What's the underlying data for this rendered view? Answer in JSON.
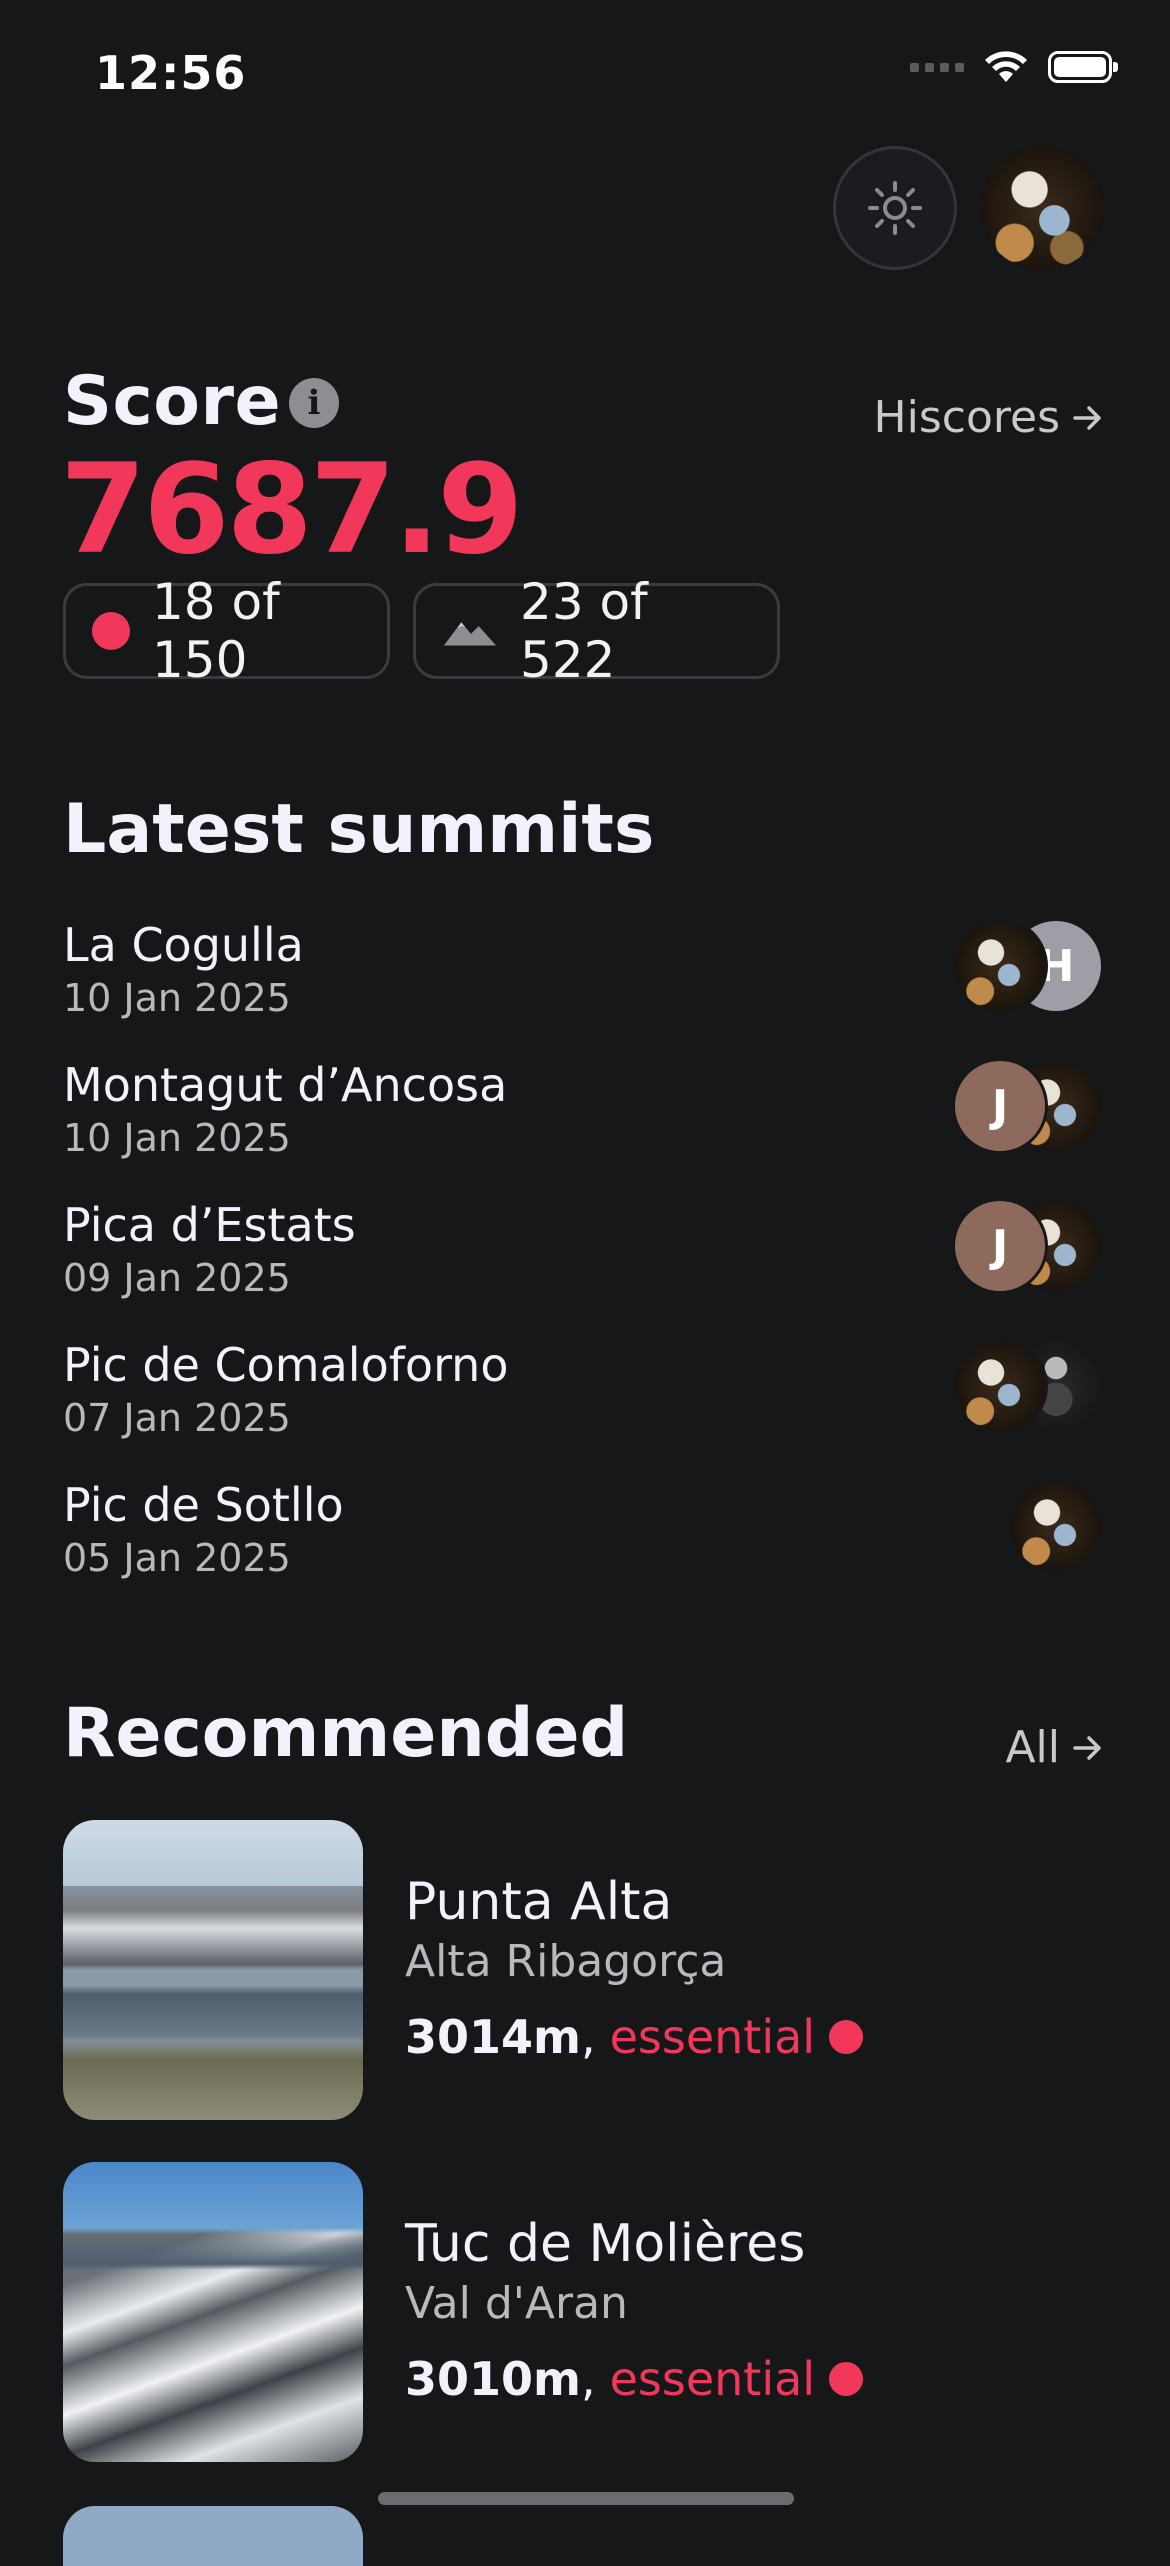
{
  "status_bar": {
    "time": "12:56"
  },
  "score": {
    "label": "Score",
    "value": "7687.9",
    "hiscores_label": "Hiscores",
    "essential_count": "18 of 150",
    "peaks_count": "23 of 522"
  },
  "latest_summits": {
    "title": "Latest summits",
    "items": [
      {
        "name": "La Cogulla",
        "date": "10 Jan 2025",
        "avatars": [
          "photo",
          "H"
        ]
      },
      {
        "name": "Montagut d’Ancosa",
        "date": "10 Jan 2025",
        "avatars": [
          "J",
          "photo"
        ]
      },
      {
        "name": "Pica d’Estats",
        "date": "09 Jan 2025",
        "avatars": [
          "J",
          "photo"
        ]
      },
      {
        "name": "Pic de Comaloforno",
        "date": "07 Jan 2025",
        "avatars": [
          "photo",
          "photo2"
        ]
      },
      {
        "name": "Pic de Sotllo",
        "date": "05 Jan 2025",
        "avatars": [
          "photo"
        ]
      }
    ]
  },
  "recommended": {
    "title": "Recommended",
    "all_label": "All",
    "items": [
      {
        "name": "Punta Alta",
        "region": "Alta Ribagorça",
        "height": "3014m",
        "tag": "essential"
      },
      {
        "name": "Tuc de Molières",
        "region": "Val d'Aran",
        "height": "3010m",
        "tag": "essential"
      }
    ]
  },
  "colors": {
    "accent": "#f2385a",
    "background": "#161719"
  },
  "icons": [
    "signal-icon",
    "wifi-icon",
    "battery-icon",
    "sun-icon",
    "info-icon",
    "arrow-right-icon",
    "mountain-icon"
  ]
}
